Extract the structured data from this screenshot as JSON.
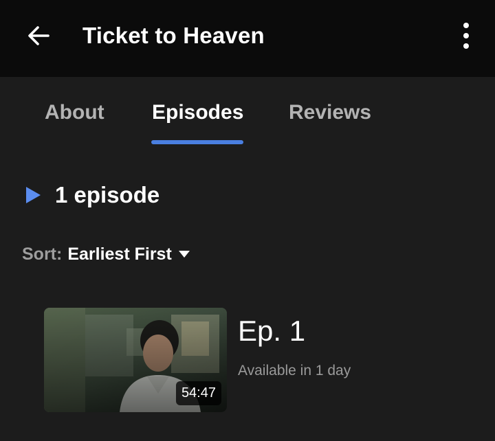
{
  "header": {
    "back_icon": "arrow-left-icon",
    "title": "Ticket to Heaven",
    "more_icon": "more-vertical-icon"
  },
  "tabs": [
    {
      "label": "About",
      "active": false
    },
    {
      "label": "Episodes",
      "active": true
    },
    {
      "label": "Reviews",
      "active": false
    }
  ],
  "colors": {
    "accent": "#4a7fe0",
    "play_icon": "#5b8def",
    "background": "#1c1c1c",
    "topbar": "#0b0b0b"
  },
  "episodes_section": {
    "play_icon": "play-triangle-icon",
    "count_text": "1 episode",
    "sort_label": "Sort:",
    "sort_value": "Earliest First",
    "sort_caret_icon": "caret-down-icon"
  },
  "episodes": [
    {
      "title": "Ep. 1",
      "status": "Available in 1 day",
      "duration": "54:47"
    }
  ]
}
